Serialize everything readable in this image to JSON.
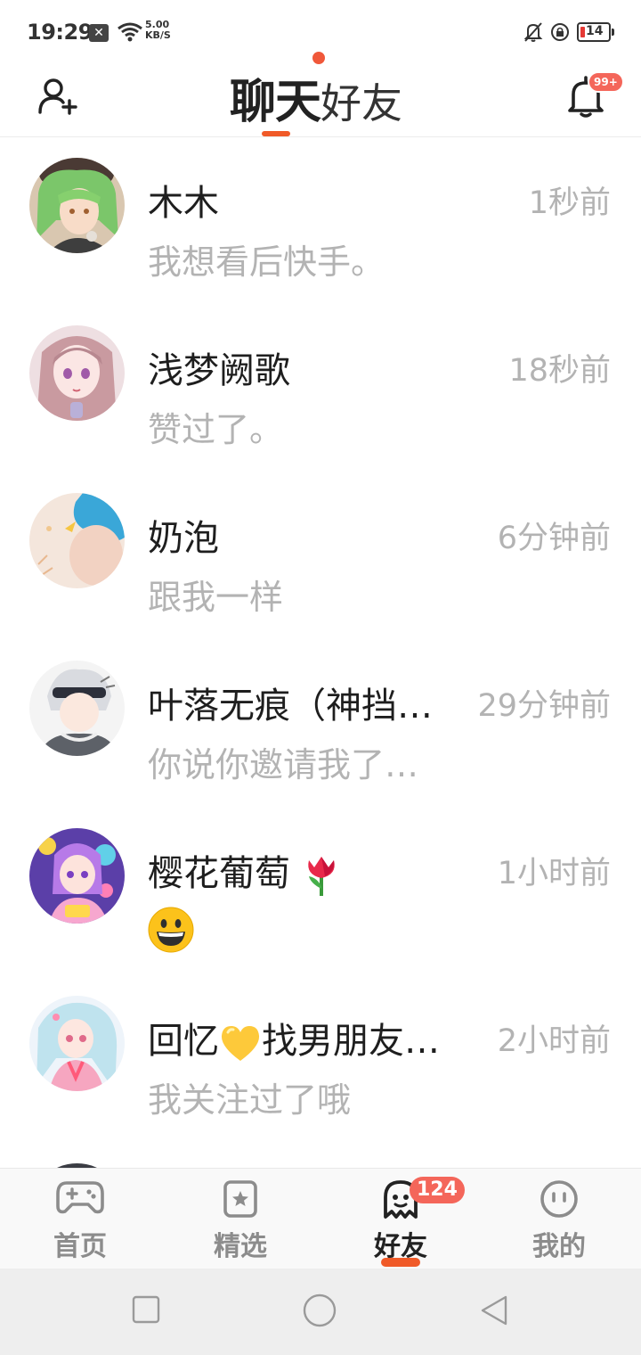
{
  "status_bar": {
    "time": "19:29",
    "x_badge": "✕",
    "net_speed_value": "5.00",
    "net_speed_unit": "KB/S",
    "battery_level": "14"
  },
  "header": {
    "title_active": "聊天",
    "title_inactive": "好友",
    "bell_badge": "99+",
    "accent_color": "#f05a28"
  },
  "chats": [
    {
      "name": "木木",
      "time": "1秒前",
      "message": "我想看后快手。"
    },
    {
      "name": "浅梦阙歌",
      "time": "18秒前",
      "message": "赞过了。"
    },
    {
      "name": "奶泡",
      "time": "6分钟前",
      "message": "跟我一样"
    },
    {
      "name": "叶落无痕（神挡…",
      "time": "29分钟前",
      "message": "你说你邀请我了…"
    },
    {
      "name": "樱花葡萄",
      "name_emoji": "tulip-emoji",
      "time": "1小时前",
      "message_emoji": "grinning-face-emoji"
    },
    {
      "name_a": "回忆",
      "name_emoji": "yellow-heart-emoji",
      "name_b": "找男朋友…",
      "time": "2小时前",
      "message": "我关注过了哦"
    }
  ],
  "bottom_nav": {
    "items": [
      {
        "label": "首页",
        "icon": "gamepad-icon"
      },
      {
        "label": "精选",
        "icon": "star-card-icon"
      },
      {
        "label": "好友",
        "icon": "ghost-icon",
        "badge": "124",
        "active": true
      },
      {
        "label": "我的",
        "icon": "face-icon"
      }
    ]
  }
}
